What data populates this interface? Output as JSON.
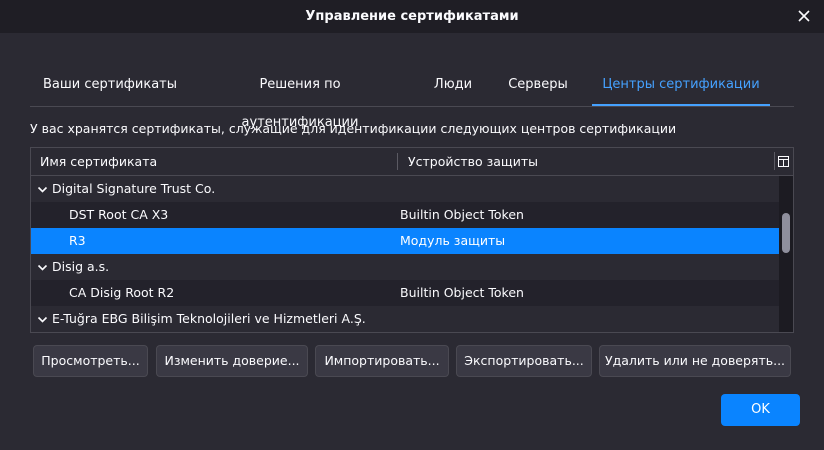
{
  "window": {
    "title": "Управление сертификатами"
  },
  "tabs": [
    {
      "label": "Ваши сертификаты",
      "active": false
    },
    {
      "label": "Решения по аутентификации",
      "active": false
    },
    {
      "label": "Люди",
      "active": false
    },
    {
      "label": "Серверы",
      "active": false
    },
    {
      "label": "Центры сертификации",
      "active": true
    }
  ],
  "description": "У вас хранятся сертификаты, служащие для идентификации следующих центров сертификации",
  "tree": {
    "columns": {
      "name": "Имя сертификата",
      "device": "Устройство защиты"
    },
    "rows": [
      {
        "type": "group",
        "name": "Digital Signature Trust Co.",
        "device": ""
      },
      {
        "type": "child",
        "name": "DST Root CA X3",
        "device": "Builtin Object Token"
      },
      {
        "type": "child",
        "name": "R3",
        "device": "Модуль защиты",
        "selected": true
      },
      {
        "type": "group",
        "name": "Disig a.s.",
        "device": ""
      },
      {
        "type": "child",
        "name": "CA Disig Root R2",
        "device": "Builtin Object Token"
      },
      {
        "type": "group",
        "name": "E-Tuğra EBG Bilişim Teknolojileri ve Hizmetleri A.Ş.",
        "device": ""
      }
    ]
  },
  "buttons": {
    "view": "Просмотреть...",
    "edit_trust": "Изменить доверие...",
    "import": "Импортировать...",
    "export": "Экспортировать...",
    "delete": "Удалить или не доверять...",
    "ok": "OK"
  },
  "colors": {
    "accent": "#0a84ff",
    "active_tab": "#45a1ff",
    "background": "#2b2a33"
  }
}
